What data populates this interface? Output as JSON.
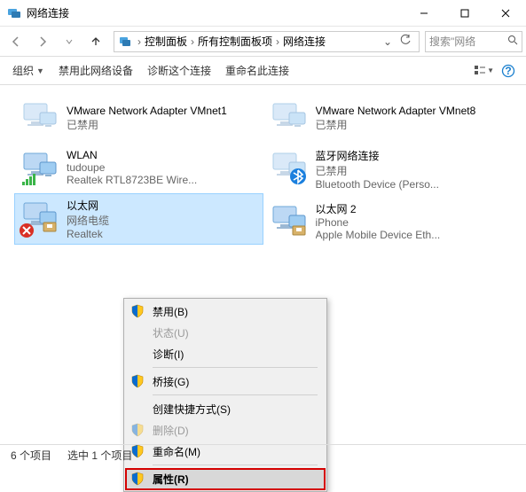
{
  "window": {
    "title": "网络连接"
  },
  "nav": {
    "crumbs": [
      "控制面板",
      "所有控制面板项",
      "网络连接"
    ],
    "search_placeholder": "搜索\"网络"
  },
  "cmdbar": {
    "organize": "组织",
    "disable": "禁用此网络设备",
    "diagnose": "诊断这个连接",
    "rename": "重命名此连接"
  },
  "adapters": {
    "left": [
      {
        "name": "VMware Network Adapter VMnet1",
        "status": "已禁用",
        "device": "",
        "type": "disabled"
      },
      {
        "name": "WLAN",
        "status": "tudoupe",
        "device": "Realtek RTL8723BE Wire...",
        "type": "wifi"
      },
      {
        "name": "以太网",
        "status": "网络电缆",
        "device": "Realtek",
        "type": "eth_err"
      }
    ],
    "right": [
      {
        "name": "VMware Network Adapter VMnet8",
        "status": "已禁用",
        "device": "",
        "type": "disabled"
      },
      {
        "name": "蓝牙网络连接",
        "status": "已禁用",
        "device": "Bluetooth Device (Perso...",
        "type": "bt"
      },
      {
        "name": "以太网 2",
        "status": "iPhone",
        "device": "Apple Mobile Device Eth...",
        "type": "eth"
      }
    ]
  },
  "menu": {
    "disable": "禁用(B)",
    "status": "状态(U)",
    "diagnose": "诊断(I)",
    "bridge": "桥接(G)",
    "shortcut": "创建快捷方式(S)",
    "delete": "删除(D)",
    "rename": "重命名(M)",
    "properties": "属性(R)"
  },
  "status": {
    "count": "6 个项目",
    "selected": "选中 1 个项目"
  }
}
